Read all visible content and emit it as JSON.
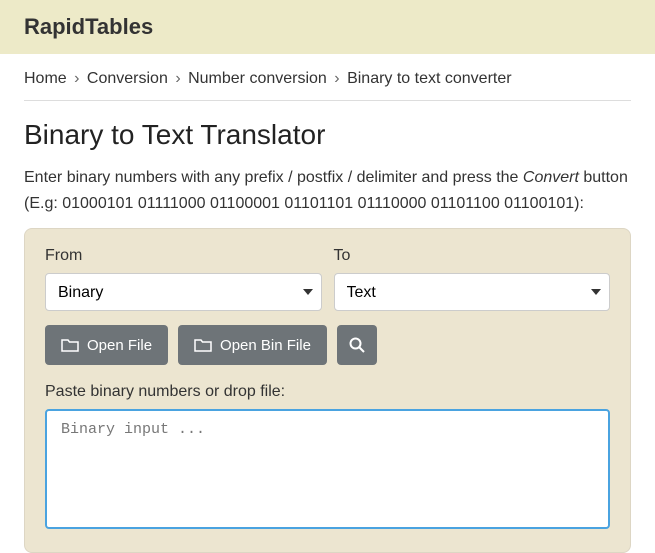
{
  "header": {
    "title": "RapidTables"
  },
  "breadcrumb": {
    "items": [
      "Home",
      "Conversion",
      "Number conversion",
      "Binary to text converter"
    ]
  },
  "page": {
    "title": "Binary to Text Translator",
    "intro_before": "Enter binary numbers with any prefix / postfix / delimiter and press the ",
    "intro_em": "Convert",
    "intro_after": " button (E.g: 01000101 01111000 01100001 01101101 01110000 01101100 01100101):"
  },
  "panel": {
    "from_label": "From",
    "to_label": "To",
    "from_value": "Binary",
    "to_value": "Text",
    "open_file_label": "Open File",
    "open_bin_label": "Open Bin File",
    "paste_label": "Paste binary numbers or drop file:",
    "textarea_placeholder": "Binary input ..."
  }
}
